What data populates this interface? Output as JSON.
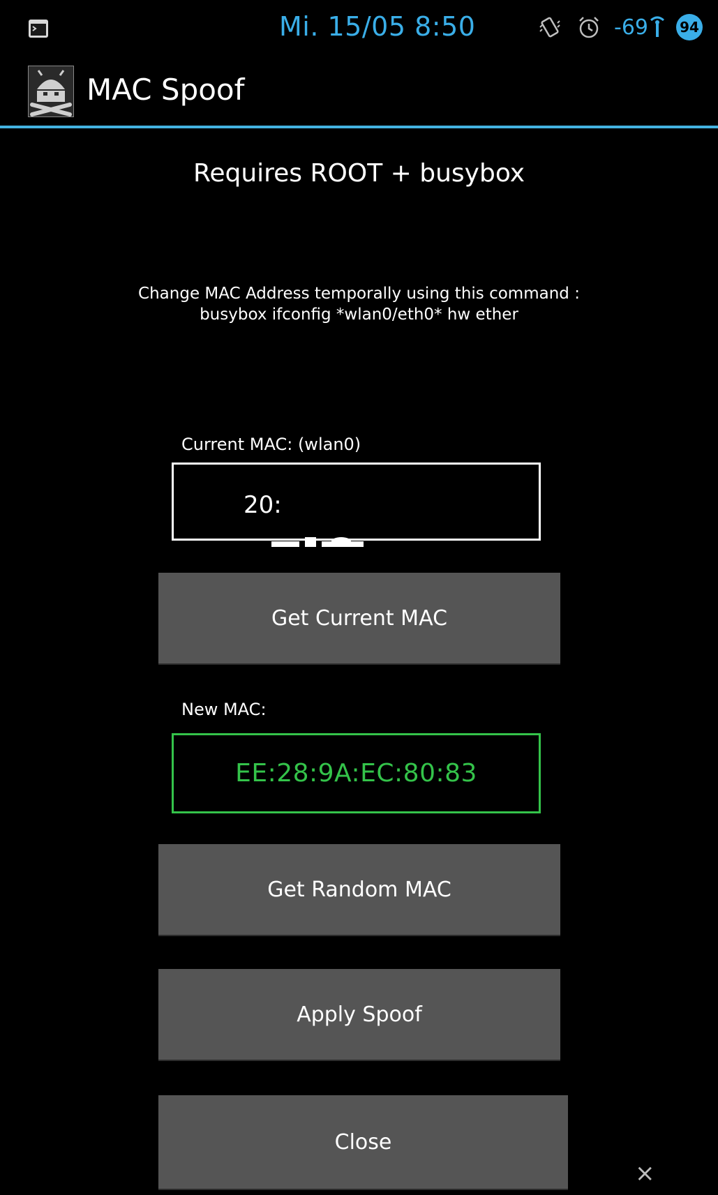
{
  "status_bar": {
    "left_icon": "terminal-notification-icon",
    "time": "Mi. 15/05 8:50",
    "icons": [
      "vibrate-icon",
      "alarm-icon",
      "wifi-signal-icon",
      "battery-icon"
    ],
    "signal_strength": "-69",
    "battery_level": "94"
  },
  "action_bar": {
    "app_icon": "mac-spoof-app-icon",
    "title": "MAC Spoof"
  },
  "main": {
    "requires": "Requires ROOT + busybox",
    "description_line1": "Change MAC Address temporally using this command :",
    "description_line2": "busybox ifconfig *wlan0/eth0* hw ether",
    "current_mac_label": "Current MAC: (wlan0)",
    "current_mac_value": "20:",
    "get_current_label": "Get Current MAC",
    "new_mac_label": "New MAC:",
    "new_mac_value": "EE:28:9A:EC:80:83",
    "get_random_label": "Get Random MAC",
    "apply_label": "Apply Spoof",
    "close_label": "Close"
  },
  "overlay": {
    "dismiss_glyph": "×"
  },
  "colors": {
    "accent_blue": "#3aaee8",
    "divider_blue": "#44b2e0",
    "new_mac_green": "#34c34a",
    "button_gray": "#555555",
    "background": "#000000"
  }
}
